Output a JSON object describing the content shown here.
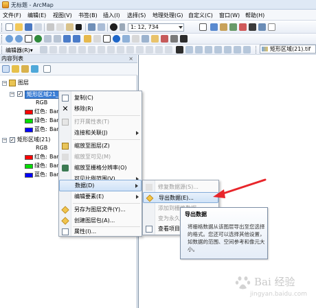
{
  "window": {
    "title": "无标题 - ArcMap"
  },
  "menubar": {
    "items": [
      "文件(F)",
      "编辑(E)",
      "视图(V)",
      "书签(B)",
      "插入(I)",
      "选择(S)",
      "地理处理(G)",
      "自定义(C)",
      "窗口(W)",
      "帮助(H)"
    ]
  },
  "toolbar": {
    "scale_value": "1: 12, 734",
    "editor_label": "编辑器(R)▾",
    "layer_combo": "矩形区域(21).tif"
  },
  "toc": {
    "header": "内容列表",
    "close_glyph": "×",
    "root_label": "图层",
    "layer1": {
      "name": "矩形区域21_R...",
      "band_mode": "RGB",
      "bands": [
        {
          "label": "红色:",
          "value": "Ban",
          "color": "#ff0000"
        },
        {
          "label": "绿色:",
          "value": "Ban",
          "color": "#00dd00"
        },
        {
          "label": "蓝色:",
          "value": "Ban",
          "color": "#0000ff"
        }
      ]
    },
    "layer2": {
      "name": "矩形区域(21)",
      "band_mode": "RGB",
      "bands": [
        {
          "label": "红色:",
          "value": "Bar",
          "color": "#ff0000"
        },
        {
          "label": "绿色:",
          "value": "Ban",
          "color": "#00dd00"
        },
        {
          "label": "蓝色:",
          "value": "Ban",
          "color": "#0000ff"
        }
      ]
    }
  },
  "context_menu": {
    "items": [
      {
        "label": "复制(C)",
        "disabled": false,
        "submenu": false,
        "icon": "copy-icon"
      },
      {
        "label": "移除(R)",
        "disabled": false,
        "submenu": false,
        "icon": "remove-icon"
      },
      {
        "label": "打开属性表(T)",
        "disabled": true,
        "submenu": false,
        "icon": "table-icon"
      },
      {
        "label": "连接和关联(J)",
        "disabled": false,
        "submenu": true,
        "icon": ""
      },
      {
        "label": "缩放至图层(Z)",
        "disabled": false,
        "submenu": false,
        "icon": "zoom-layer-icon"
      },
      {
        "label": "缩放至可见(M)",
        "disabled": true,
        "submenu": false,
        "icon": "zoom-visible-icon"
      },
      {
        "label": "缩放至栅格分辨率(O)",
        "disabled": false,
        "submenu": false,
        "icon": "zoom-raster-icon"
      },
      {
        "label": "可见比例范围(V)",
        "disabled": false,
        "submenu": true,
        "icon": ""
      },
      {
        "label": "数据(D)",
        "disabled": false,
        "submenu": true,
        "icon": "",
        "highlighted": true
      },
      {
        "label": "编辑要素(E)",
        "disabled": false,
        "submenu": true,
        "icon": ""
      },
      {
        "label": "另存为图层文件(Y)...",
        "disabled": false,
        "submenu": false,
        "icon": "layer-file-icon"
      },
      {
        "label": "创建图层包(A)...",
        "disabled": false,
        "submenu": false,
        "icon": "layer-package-icon"
      },
      {
        "label": "属性(I)...",
        "disabled": false,
        "submenu": false,
        "icon": "properties-icon"
      }
    ]
  },
  "data_submenu": {
    "items": [
      {
        "label": "修复数据源(S)...",
        "disabled": true
      },
      {
        "label": "导出数据(E)...",
        "disabled": false,
        "highlighted": true
      },
      {
        "label": "添加到栅格数据...",
        "disabled": true
      },
      {
        "label": "变为永久",
        "disabled": true
      },
      {
        "label": "查看项目",
        "disabled": false
      }
    ]
  },
  "tooltip": {
    "title": "导出数据",
    "body": "将栅格数据从该图层导出至您选择的格式。您还可以选择其他设置，如数据的范围、空间参考和像元大小。"
  },
  "watermark": {
    "text": "Bai 经验",
    "url": "jingyan.baidu.com"
  },
  "colors": {
    "highlight": "#cfe2f7",
    "arrow": "#e8262b"
  }
}
